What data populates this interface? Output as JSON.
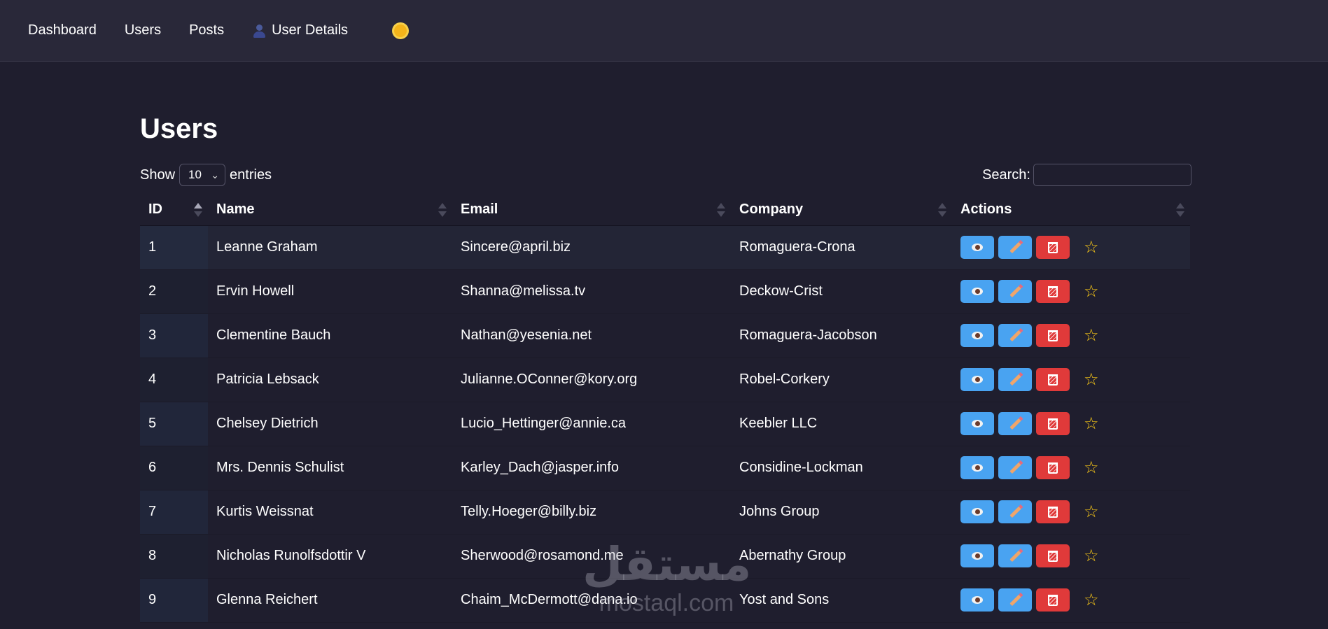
{
  "nav": {
    "items": [
      {
        "label": "Dashboard"
      },
      {
        "label": "Users"
      },
      {
        "label": "Posts"
      },
      {
        "label": "User Details"
      }
    ],
    "theme_toggle_icon": "sun-icon"
  },
  "page": {
    "title": "Users"
  },
  "controls": {
    "show_label": "Show",
    "entries_value": "10",
    "entries_label": "entries",
    "search_label": "Search:",
    "search_value": ""
  },
  "table": {
    "columns": [
      "ID",
      "Name",
      "Email",
      "Company",
      "Actions"
    ],
    "sort": {
      "column": "ID",
      "direction": "ascending"
    },
    "rows": [
      {
        "id": "1",
        "name": "Leanne Graham",
        "email": "Sincere@april.biz",
        "company": "Romaguera-Crona"
      },
      {
        "id": "2",
        "name": "Ervin Howell",
        "email": "Shanna@melissa.tv",
        "company": "Deckow-Crist"
      },
      {
        "id": "3",
        "name": "Clementine Bauch",
        "email": "Nathan@yesenia.net",
        "company": "Romaguera-Jacobson"
      },
      {
        "id": "4",
        "name": "Patricia Lebsack",
        "email": "Julianne.OConner@kory.org",
        "company": "Robel-Corkery"
      },
      {
        "id": "5",
        "name": "Chelsey Dietrich",
        "email": "Lucio_Hettinger@annie.ca",
        "company": "Keebler LLC"
      },
      {
        "id": "6",
        "name": "Mrs. Dennis Schulist",
        "email": "Karley_Dach@jasper.info",
        "company": "Considine-Lockman"
      },
      {
        "id": "7",
        "name": "Kurtis Weissnat",
        "email": "Telly.Hoeger@billy.biz",
        "company": "Johns Group"
      },
      {
        "id": "8",
        "name": "Nicholas Runolfsdottir V",
        "email": "Sherwood@rosamond.me",
        "company": "Abernathy Group"
      },
      {
        "id": "9",
        "name": "Glenna Reichert",
        "email": "Chaim_McDermott@dana.io",
        "company": "Yost and Sons"
      }
    ],
    "row_action_icons": [
      "eye-icon",
      "pencil-icon",
      "wastebasket-icon",
      "star-icon"
    ]
  },
  "watermark": {
    "arabic": "مستقل",
    "domain": "mostaql.com"
  },
  "colors": {
    "background": "#1f1e2e",
    "navbar": "#292839",
    "view_edit_button": "#49a3f1",
    "delete_button": "#e03a3a",
    "star": "#f5c518"
  }
}
